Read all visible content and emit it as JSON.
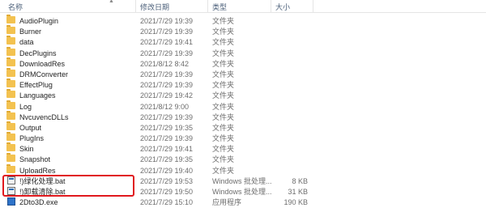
{
  "columns": {
    "name": "名称",
    "date": "修改日期",
    "type": "类型",
    "size": "大小"
  },
  "rows": [
    {
      "name": "AudioPlugin",
      "date": "2021/7/29 19:39",
      "type": "文件夹",
      "size": "",
      "icon": "folder-icon"
    },
    {
      "name": "Burner",
      "date": "2021/7/29 19:39",
      "type": "文件夹",
      "size": "",
      "icon": "folder-icon"
    },
    {
      "name": "data",
      "date": "2021/7/29 19:41",
      "type": "文件夹",
      "size": "",
      "icon": "folder-icon"
    },
    {
      "name": "DecPlugins",
      "date": "2021/7/29 19:39",
      "type": "文件夹",
      "size": "",
      "icon": "folder-icon"
    },
    {
      "name": "DownloadRes",
      "date": "2021/8/12 8:42",
      "type": "文件夹",
      "size": "",
      "icon": "folder-icon"
    },
    {
      "name": "DRMConverter",
      "date": "2021/7/29 19:39",
      "type": "文件夹",
      "size": "",
      "icon": "folder-icon"
    },
    {
      "name": "EffectPlug",
      "date": "2021/7/29 19:39",
      "type": "文件夹",
      "size": "",
      "icon": "folder-icon"
    },
    {
      "name": "Languages",
      "date": "2021/7/29 19:42",
      "type": "文件夹",
      "size": "",
      "icon": "folder-icon"
    },
    {
      "name": "Log",
      "date": "2021/8/12 9:00",
      "type": "文件夹",
      "size": "",
      "icon": "folder-icon"
    },
    {
      "name": "NvcuvencDLLs",
      "date": "2021/7/29 19:39",
      "type": "文件夹",
      "size": "",
      "icon": "folder-icon"
    },
    {
      "name": "Output",
      "date": "2021/7/29 19:35",
      "type": "文件夹",
      "size": "",
      "icon": "folder-icon"
    },
    {
      "name": "PlugIns",
      "date": "2021/7/29 19:39",
      "type": "文件夹",
      "size": "",
      "icon": "folder-icon"
    },
    {
      "name": "Skin",
      "date": "2021/7/29 19:41",
      "type": "文件夹",
      "size": "",
      "icon": "folder-icon"
    },
    {
      "name": "Snapshot",
      "date": "2021/7/29 19:35",
      "type": "文件夹",
      "size": "",
      "icon": "folder-icon"
    },
    {
      "name": "UploadRes",
      "date": "2021/7/29 19:40",
      "type": "文件夹",
      "size": "",
      "icon": "folder-icon"
    },
    {
      "name": "!)绿化处理.bat",
      "date": "2021/7/29 19:53",
      "type": "Windows 批处理...",
      "size": "8 KB",
      "icon": "bat-file-icon"
    },
    {
      "name": "!)卸载清除.bat",
      "date": "2021/7/29 19:50",
      "type": "Windows 批处理...",
      "size": "31 KB",
      "icon": "bat-file-icon"
    },
    {
      "name": "2Dto3D.exe",
      "date": "2021/7/29 15:10",
      "type": "应用程序",
      "size": "190 KB",
      "icon": "exe-file-icon"
    }
  ]
}
